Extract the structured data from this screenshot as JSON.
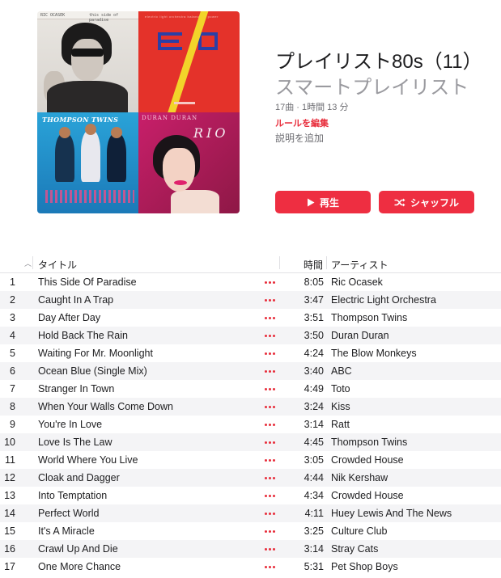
{
  "playlist": {
    "title": "プレイリスト80s（11）",
    "subtitle": "スマートプレイリスト",
    "meta": "17曲 · 1時間 13 分",
    "edit_rules": "ルールを編集",
    "add_description": "説明を追加",
    "play_label": "再生",
    "shuffle_label": "シャッフル",
    "accent_color": "#ee2e41"
  },
  "artwork": {
    "covers": [
      {
        "name": "ric-ocasek-cover",
        "text_left": "RIC OCASEK",
        "text_right": "this side of paradise"
      },
      {
        "name": "elo-cover",
        "text": "electric light orchestra  balance of power"
      },
      {
        "name": "thompson-twins-cover",
        "text": "THOMPSON TWINS"
      },
      {
        "name": "duran-duran-cover",
        "text": "DURAN DURAN",
        "text2": "RIO"
      }
    ]
  },
  "columns": {
    "title": "タイトル",
    "time": "時間",
    "artist": "アーティスト"
  },
  "tracks": [
    {
      "num": "1",
      "title": "This Side Of Paradise",
      "time": "8:05",
      "artist": "Ric Ocasek"
    },
    {
      "num": "2",
      "title": "Caught In A Trap",
      "time": "3:47",
      "artist": "Electric Light Orchestra"
    },
    {
      "num": "3",
      "title": "Day After Day",
      "time": "3:51",
      "artist": "Thompson Twins"
    },
    {
      "num": "4",
      "title": "Hold Back The Rain",
      "time": "3:50",
      "artist": "Duran Duran"
    },
    {
      "num": "5",
      "title": "Waiting For Mr. Moonlight",
      "time": "4:24",
      "artist": "The Blow Monkeys"
    },
    {
      "num": "6",
      "title": "Ocean Blue (Single Mix)",
      "time": "3:40",
      "artist": "ABC"
    },
    {
      "num": "7",
      "title": "Stranger In Town",
      "time": "4:49",
      "artist": "Toto"
    },
    {
      "num": "8",
      "title": "When Your Walls Come Down",
      "time": "3:24",
      "artist": "Kiss"
    },
    {
      "num": "9",
      "title": "You're In Love",
      "time": "3:14",
      "artist": "Ratt"
    },
    {
      "num": "10",
      "title": "Love Is The Law",
      "time": "4:45",
      "artist": "Thompson Twins"
    },
    {
      "num": "11",
      "title": "World Where You Live",
      "time": "3:05",
      "artist": "Crowded House"
    },
    {
      "num": "12",
      "title": "Cloak and Dagger",
      "time": "4:44",
      "artist": "Nik Kershaw"
    },
    {
      "num": "13",
      "title": "Into Temptation",
      "time": "4:34",
      "artist": "Crowded House"
    },
    {
      "num": "14",
      "title": "Perfect World",
      "time": "4:11",
      "artist": "Huey Lewis And The News"
    },
    {
      "num": "15",
      "title": "It's A Miracle",
      "time": "3:25",
      "artist": "Culture Club"
    },
    {
      "num": "16",
      "title": "Crawl Up And Die",
      "time": "3:14",
      "artist": "Stray Cats"
    },
    {
      "num": "17",
      "title": "One More Chance",
      "time": "5:31",
      "artist": "Pet Shop Boys"
    }
  ]
}
